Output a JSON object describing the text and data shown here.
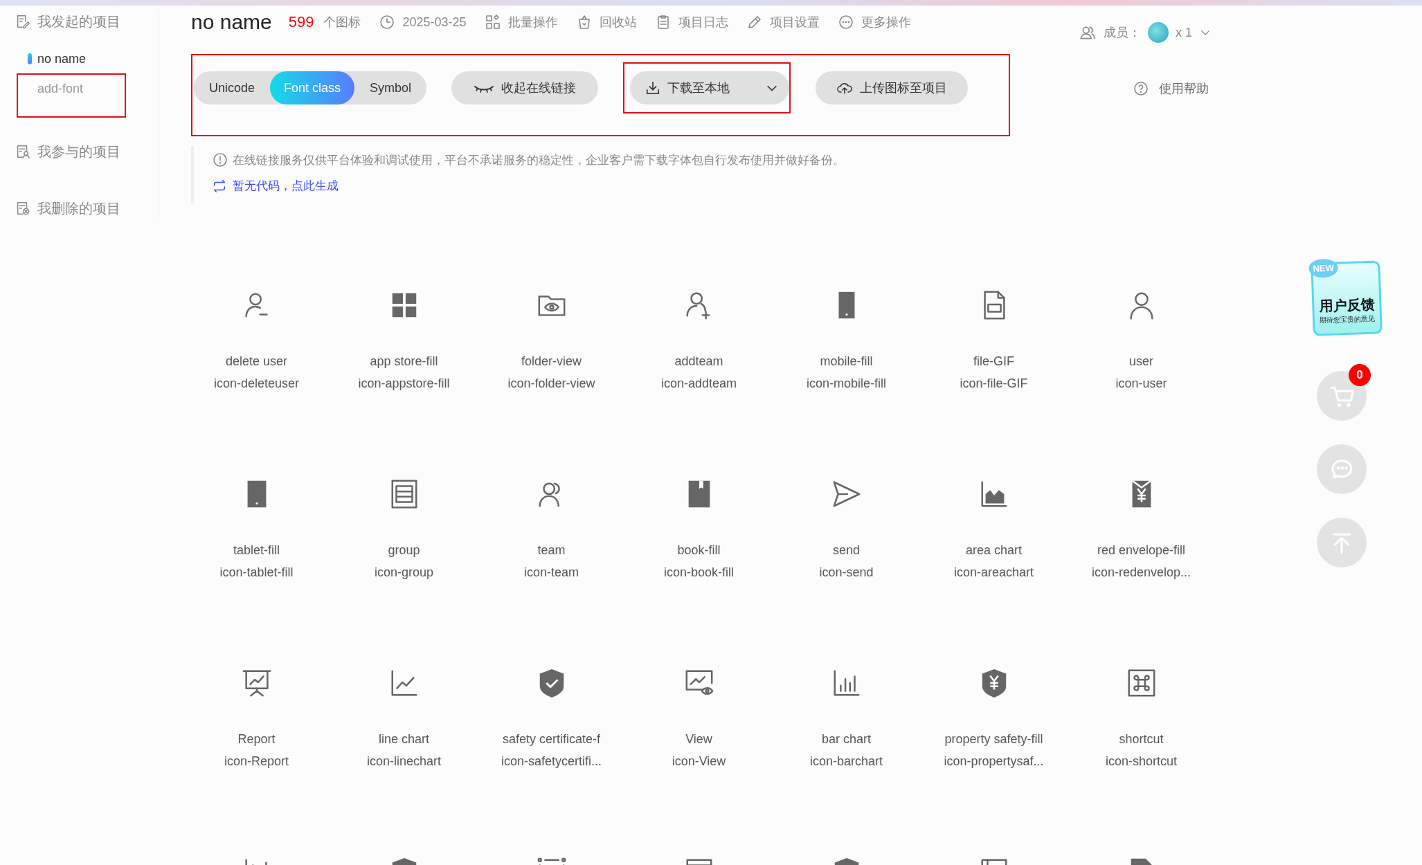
{
  "sidebar": {
    "sections": [
      {
        "label": "我发起的项目",
        "children": [
          {
            "label": "no name",
            "selected": true,
            "marked": false
          },
          {
            "label": "add-font",
            "selected": false,
            "marked": true
          }
        ]
      },
      {
        "label": "我参与的项目"
      },
      {
        "label": "我删除的项目"
      }
    ]
  },
  "header": {
    "title": "no name",
    "icon_count": "599",
    "icon_count_label": "个图标",
    "date": "2025-03-25",
    "actions": [
      "批量操作",
      "回收站",
      "项目日志",
      "项目设置",
      "更多操作"
    ],
    "members_label": "成员：",
    "members_count": "x 1"
  },
  "toolbar": {
    "marked": true,
    "formats": [
      {
        "label": "Unicode",
        "selected": false
      },
      {
        "label": "Font class",
        "selected": true
      },
      {
        "label": "Symbol",
        "selected": false
      }
    ],
    "collapse_link": "收起在线链接",
    "download": {
      "label": "下载至本地",
      "marked": true
    },
    "upload": "上传图标至项目",
    "help": "使用帮助"
  },
  "notice": {
    "text": "在线链接服务仅供平台体验和调试使用，平台不承诺服务的稳定性，企业客户需下载字体包自行发布使用并做好备份。",
    "generate_link": "暂无代码，点此生成"
  },
  "icons": [
    {
      "kind": "full",
      "name": "delete user",
      "code": "icon-deleteuser"
    },
    {
      "kind": "full",
      "name": "app store-fill",
      "code": "icon-appstore-fill"
    },
    {
      "kind": "full",
      "name": "folder-view",
      "code": "icon-folder-view"
    },
    {
      "kind": "full",
      "name": "addteam",
      "code": "icon-addteam"
    },
    {
      "kind": "full",
      "name": "mobile-fill",
      "code": "icon-mobile-fill"
    },
    {
      "kind": "full",
      "name": "file-GIF",
      "code": "icon-file-GIF"
    },
    {
      "kind": "full",
      "name": "user",
      "code": "icon-user"
    },
    {
      "kind": "full",
      "name": "tablet-fill",
      "code": "icon-tablet-fill"
    },
    {
      "kind": "full",
      "name": "group",
      "code": "icon-group"
    },
    {
      "kind": "full",
      "name": "team",
      "code": "icon-team"
    },
    {
      "kind": "full",
      "name": "book-fill",
      "code": "icon-book-fill"
    },
    {
      "kind": "full",
      "name": "send",
      "code": "icon-send"
    },
    {
      "kind": "full",
      "name": "area chart",
      "code": "icon-areachart"
    },
    {
      "kind": "full",
      "name": "red envelope-fill",
      "code": "icon-redenvelop..."
    },
    {
      "kind": "full",
      "name": "Report",
      "code": "icon-Report"
    },
    {
      "kind": "full",
      "name": "line chart",
      "code": "icon-linechart"
    },
    {
      "kind": "full",
      "name": "safety certificate-f",
      "code": "icon-safetycertifi..."
    },
    {
      "kind": "full",
      "name": "View",
      "code": "icon-View"
    },
    {
      "kind": "full",
      "name": "bar chart",
      "code": "icon-barchart"
    },
    {
      "kind": "full",
      "name": "property safety-fill",
      "code": "icon-propertysaf..."
    },
    {
      "kind": "full",
      "name": "shortcut",
      "code": "icon-shortcut"
    },
    {
      "kind": "cut"
    },
    {
      "kind": "cut"
    },
    {
      "kind": "cut"
    },
    {
      "kind": "cut"
    },
    {
      "kind": "cut"
    },
    {
      "kind": "cut"
    },
    {
      "kind": "cut"
    }
  ],
  "float_bar": {
    "feedback": {
      "badge": "NEW",
      "title": "用户反馈",
      "subtitle": "期待您宝贵的意见"
    },
    "cart_count": "0"
  }
}
